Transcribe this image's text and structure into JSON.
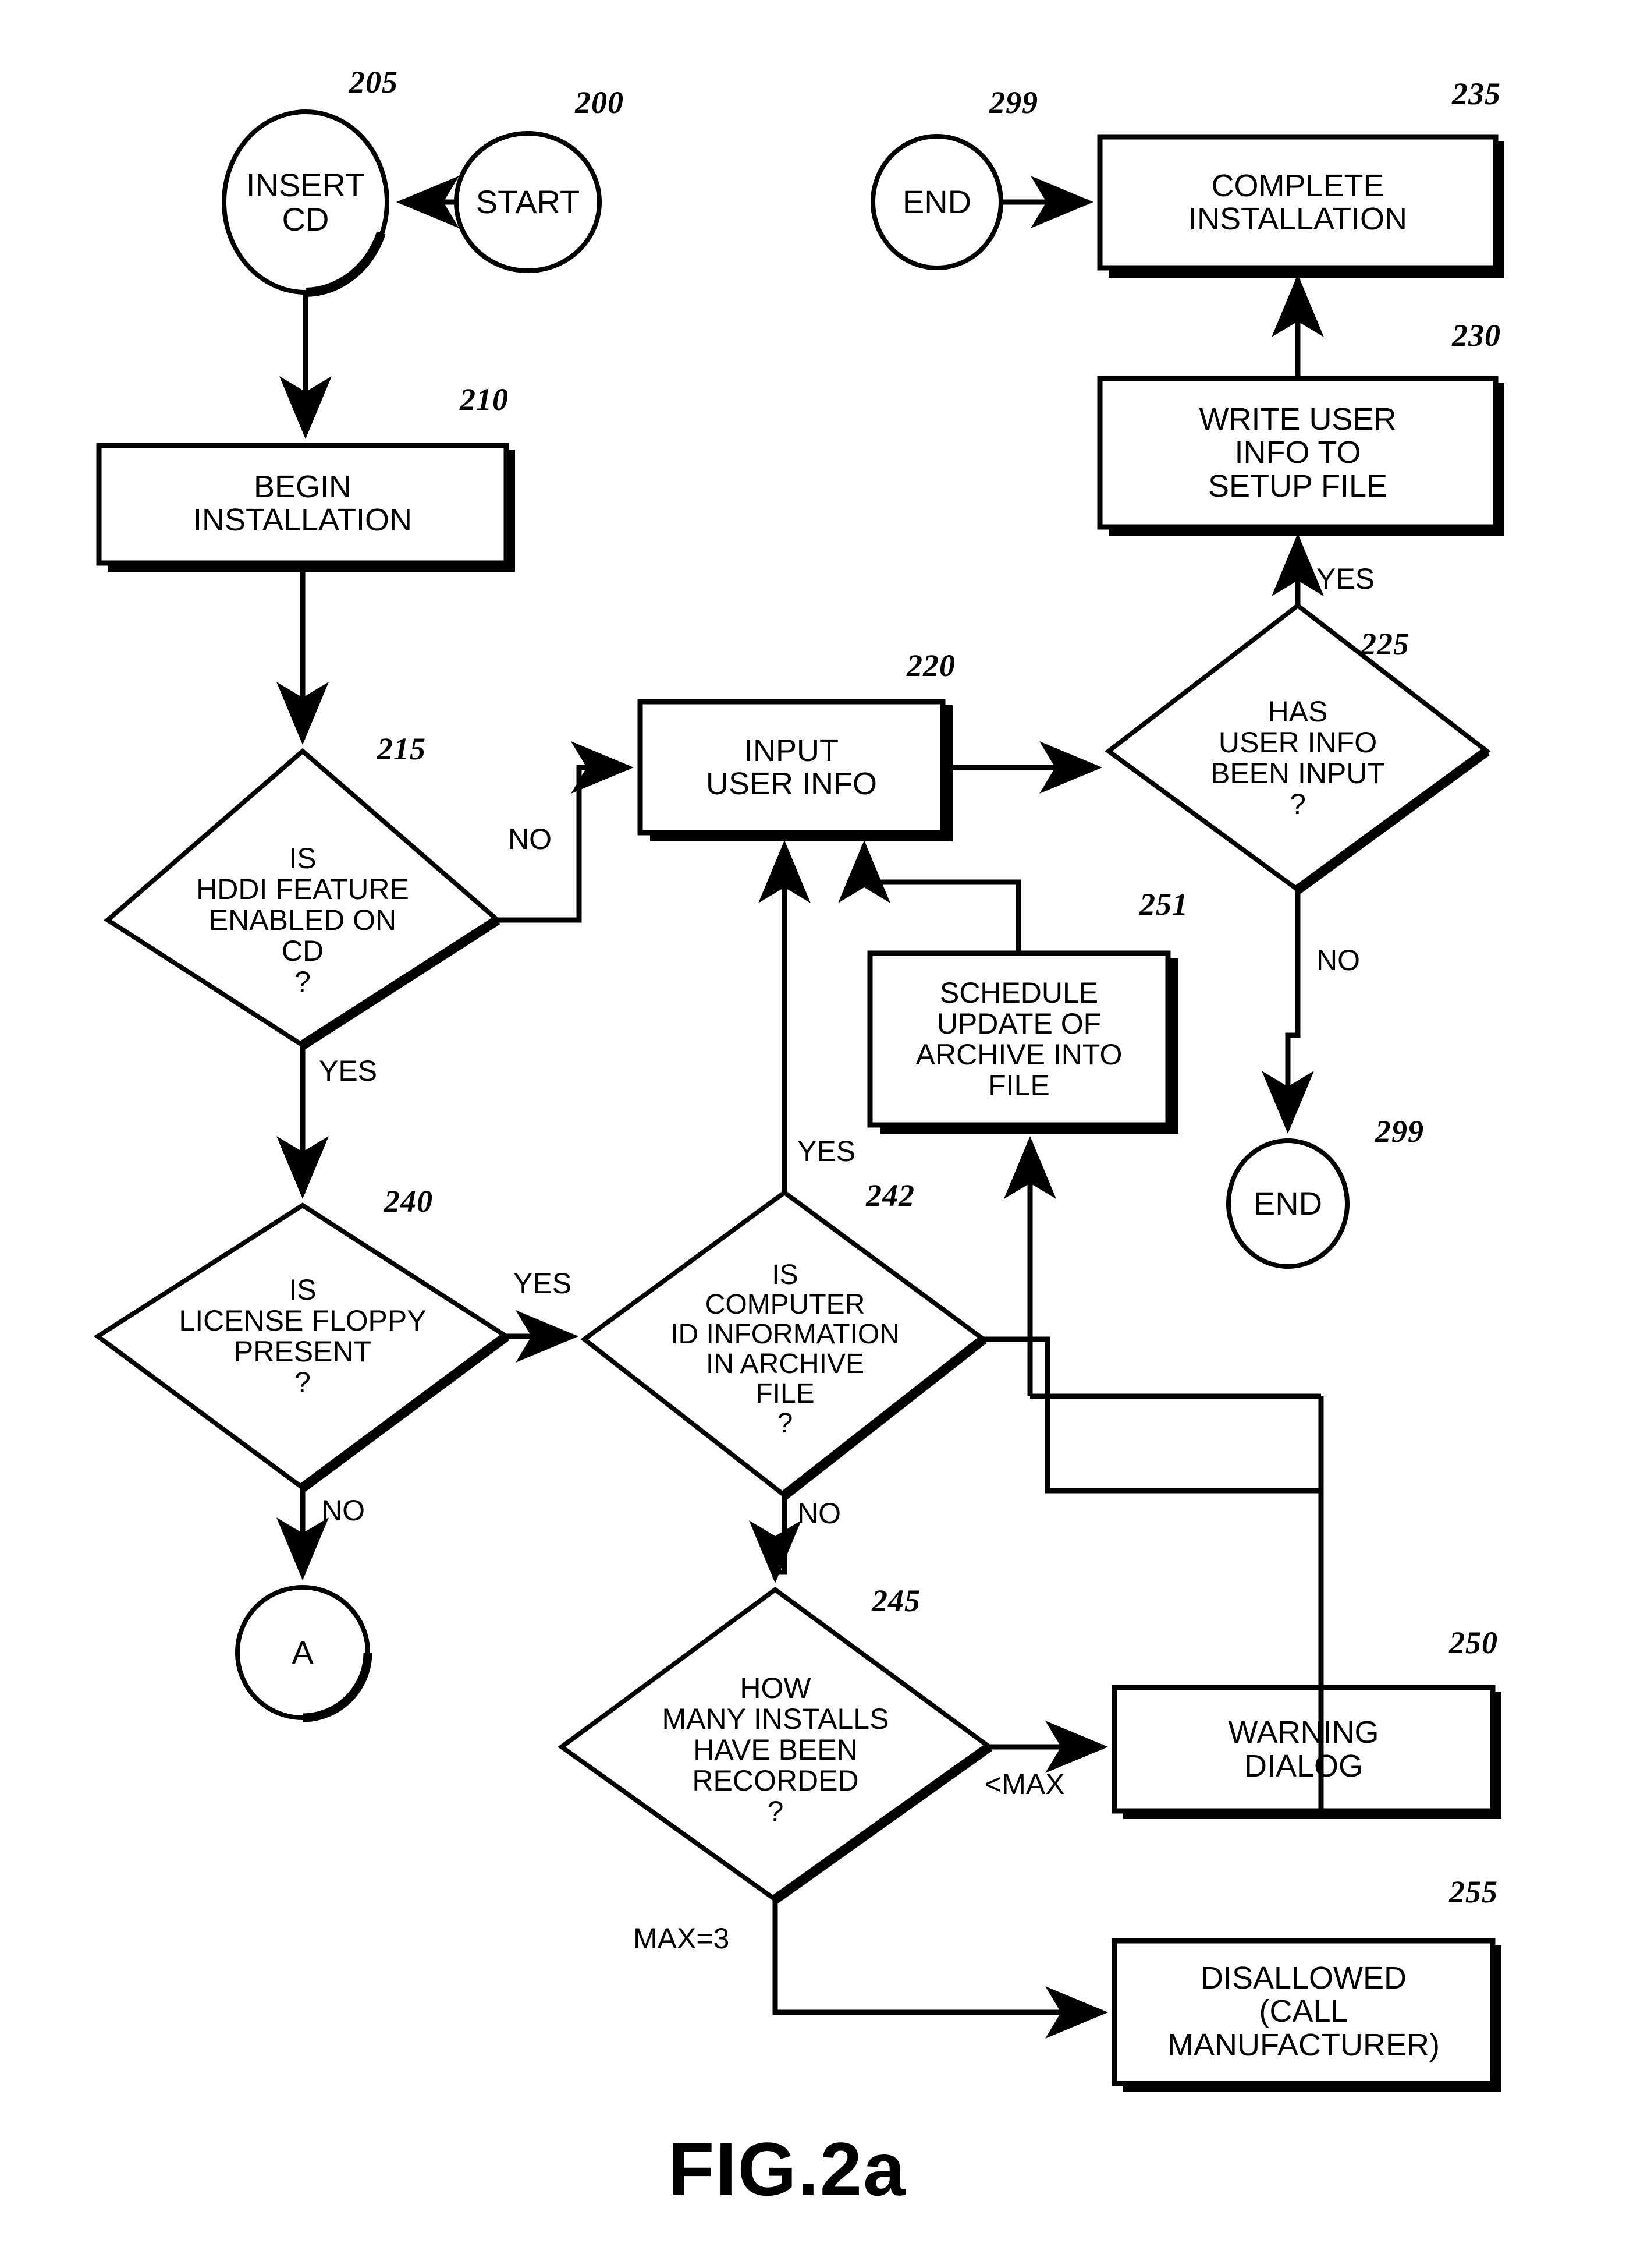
{
  "figure": {
    "caption": "FIG.2a"
  },
  "nodes": [
    {
      "id": "start",
      "ref": "200",
      "shape": "ellipse",
      "label": "START"
    },
    {
      "id": "insert_cd",
      "ref": "205",
      "shape": "ellipse",
      "label": "INSERT\nCD"
    },
    {
      "id": "begin_inst",
      "ref": "210",
      "shape": "process",
      "label": "BEGIN\nINSTALLATION"
    },
    {
      "id": "hddi",
      "ref": "215",
      "shape": "decision",
      "label": "IS\nHDDI FEATURE\nENABLED ON\nCD\n?"
    },
    {
      "id": "input_user",
      "ref": "220",
      "shape": "process",
      "label": "INPUT\nUSER INFO"
    },
    {
      "id": "has_user",
      "ref": "225",
      "shape": "decision",
      "label": "HAS\nUSER INFO\nBEEN INPUT\n?"
    },
    {
      "id": "write_user",
      "ref": "230",
      "shape": "process",
      "label": "WRITE USER\nINFO TO\nSETUP FILE"
    },
    {
      "id": "complete",
      "ref": "235",
      "shape": "process",
      "label": "COMPLETE\nINSTALLATION"
    },
    {
      "id": "end_top",
      "ref": "299",
      "shape": "ellipse",
      "label": "END"
    },
    {
      "id": "end_mid",
      "ref": "299",
      "shape": "ellipse",
      "label": "END"
    },
    {
      "id": "license",
      "ref": "240",
      "shape": "decision",
      "label": "IS\nLICENSE FLOPPY\nPRESENT\n?"
    },
    {
      "id": "computer_id",
      "ref": "242",
      "shape": "decision",
      "label": "IS\nCOMPUTER\nID INFORMATION\nIN ARCHIVE\nFILE\n?"
    },
    {
      "id": "installs",
      "ref": "245",
      "shape": "decision",
      "label": "HOW\nMANY INSTALLS\nHAVE BEEN\nRECORDED\n?"
    },
    {
      "id": "warning",
      "ref": "250",
      "shape": "process",
      "label": "WARNING\nDIALOG"
    },
    {
      "id": "schedule",
      "ref": "251",
      "shape": "process",
      "label": "SCHEDULE\nUPDATE OF\nARCHIVE INTO\nFILE"
    },
    {
      "id": "disallowed",
      "ref": "255",
      "shape": "process",
      "label": "DISALLOWED\n(CALL\nMANUFACTURER)"
    },
    {
      "id": "connector_a",
      "ref": "",
      "shape": "circle",
      "label": "A"
    }
  ],
  "edge_labels": [
    {
      "id": "hddi_no",
      "text": "NO"
    },
    {
      "id": "hddi_yes",
      "text": "YES"
    },
    {
      "id": "has_user_yes",
      "text": "YES"
    },
    {
      "id": "has_user_no",
      "text": "NO"
    },
    {
      "id": "license_yes",
      "text": "YES"
    },
    {
      "id": "license_no",
      "text": "NO"
    },
    {
      "id": "compid_yes",
      "text": "YES"
    },
    {
      "id": "compid_no",
      "text": "NO"
    },
    {
      "id": "installs_lt",
      "text": "<MAX"
    },
    {
      "id": "installs_max",
      "text": "MAX=3"
    }
  ],
  "colors": {
    "ink": "#000000",
    "paper": "#ffffff"
  }
}
